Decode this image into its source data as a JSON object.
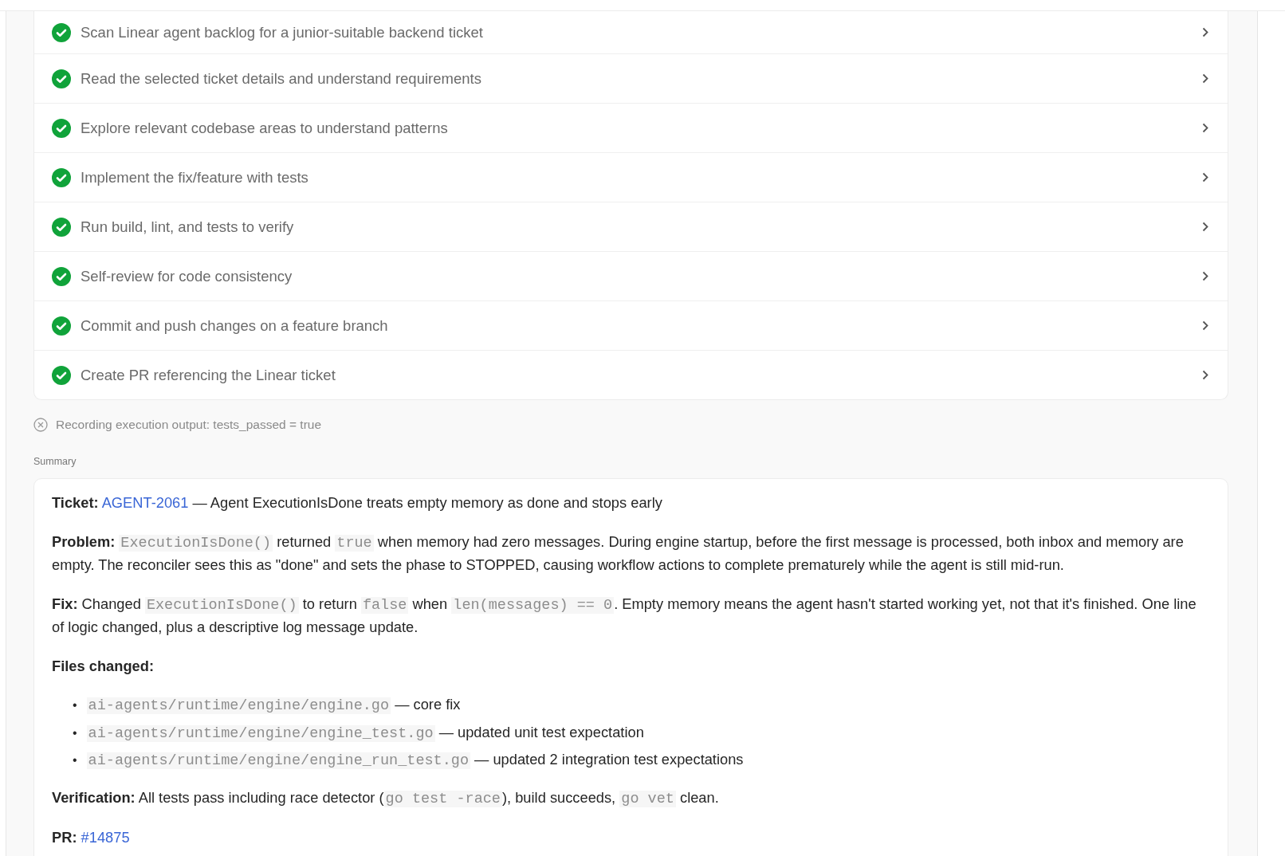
{
  "steps": [
    {
      "label": "Scan Linear agent backlog for a junior-suitable backend ticket",
      "done": true
    },
    {
      "label": "Read the selected ticket details and understand requirements",
      "done": true
    },
    {
      "label": "Explore relevant codebase areas to understand patterns",
      "done": true
    },
    {
      "label": "Implement the fix/feature with tests",
      "done": true
    },
    {
      "label": "Run build, lint, and tests to verify",
      "done": true
    },
    {
      "label": "Self-review for code consistency",
      "done": true
    },
    {
      "label": "Commit and push changes on a feature branch",
      "done": true
    },
    {
      "label": "Create PR referencing the Linear ticket",
      "done": true
    }
  ],
  "status_line": "Recording execution output: tests_passed = true",
  "summary": {
    "heading": "Summary",
    "paragraphs": [
      [
        {
          "kind": "bold",
          "text": "Ticket:"
        },
        {
          "kind": "link",
          "text": "AGENT-2061"
        },
        {
          "kind": "text",
          "text": " — Agent ExecutionIsDone treats empty memory as done and stops early"
        }
      ],
      [
        {
          "kind": "bold",
          "text": "Problem:"
        },
        {
          "kind": "code",
          "text": "ExecutionIsDone()"
        },
        {
          "kind": "text",
          "text": " returned "
        },
        {
          "kind": "code",
          "text": "true"
        },
        {
          "kind": "text",
          "text": " when memory had zero messages. During engine startup, before the first message is processed, both inbox and memory are empty. The reconciler sees this as \"done\" and sets the phase to STOPPED, causing workflow actions to complete prematurely while the agent is still mid-run."
        }
      ],
      [
        {
          "kind": "bold",
          "text": "Fix:"
        },
        {
          "kind": "text",
          "text": " Changed "
        },
        {
          "kind": "code",
          "text": "ExecutionIsDone()"
        },
        {
          "kind": "text",
          "text": " to return "
        },
        {
          "kind": "code",
          "text": "false"
        },
        {
          "kind": "text",
          "text": " when "
        },
        {
          "kind": "code",
          "text": "len(messages) == 0"
        },
        {
          "kind": "text",
          "text": ". Empty memory means the agent hasn't started working yet, not that it's finished. One line of logic changed, plus a descriptive log message update."
        }
      ],
      [
        {
          "kind": "bold",
          "text": "Files changed:"
        }
      ]
    ],
    "files": [
      {
        "bullet": "•",
        "path": "ai-agents/runtime/engine/engine.go",
        "note": " — core fix"
      },
      {
        "bullet": "•",
        "path": "ai-agents/runtime/engine/engine_test.go",
        "note": " — updated unit test expectation"
      },
      {
        "bullet": "•",
        "path": "ai-agents/runtime/engine/engine_run_test.go",
        "note": " — updated 2 integration test expectations"
      }
    ],
    "closing": [
      [
        {
          "kind": "bold",
          "text": "Verification:"
        },
        {
          "kind": "text",
          "text": " All tests pass including race detector ("
        },
        {
          "kind": "code",
          "text": "go test -race"
        },
        {
          "kind": "text",
          "text": "), build succeeds, "
        },
        {
          "kind": "code",
          "text": "go vet"
        },
        {
          "kind": "text",
          "text": " clean."
        }
      ],
      [
        {
          "kind": "bold",
          "text": "PR:"
        },
        {
          "kind": "link",
          "text": "#14875"
        }
      ]
    ]
  }
}
